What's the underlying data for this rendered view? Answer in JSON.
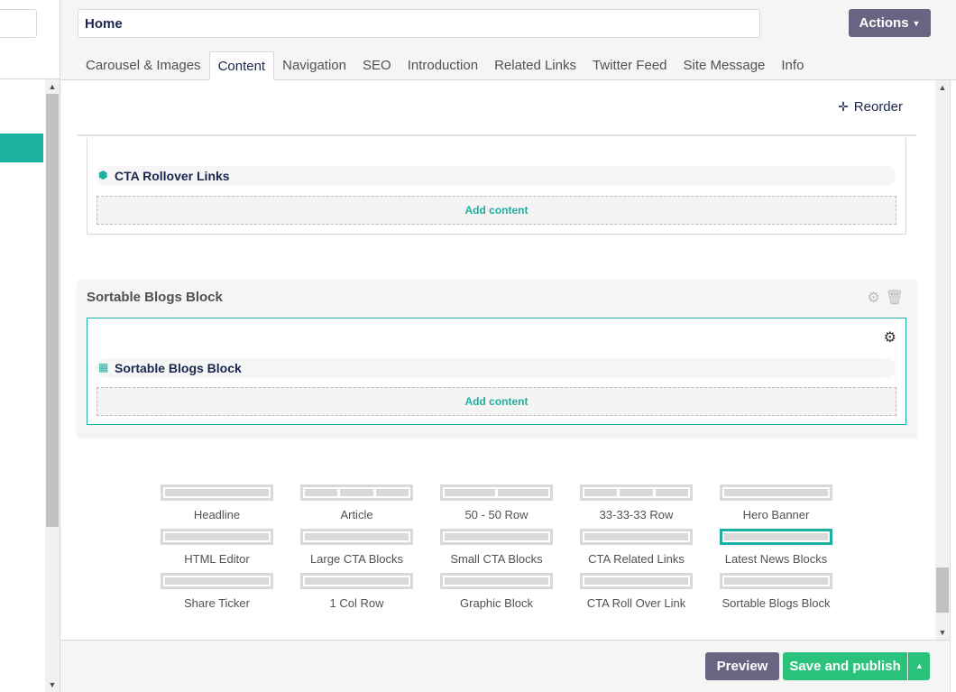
{
  "editor": {
    "name_value": "Home",
    "actions_label": "Actions"
  },
  "tabs": [
    {
      "label": "Carousel & Images"
    },
    {
      "label": "Content"
    },
    {
      "label": "Navigation"
    },
    {
      "label": "SEO"
    },
    {
      "label": "Introduction"
    },
    {
      "label": "Related Links"
    },
    {
      "label": "Twitter Feed"
    },
    {
      "label": "Site Message"
    },
    {
      "label": "Info"
    }
  ],
  "active_tab": "Content",
  "content": {
    "reorder_label": "Reorder",
    "cta_block": {
      "row_label": "CTA Rollover Links",
      "row_icon": "cube-icon",
      "add_content_label": "Add content"
    },
    "sortable_section": {
      "title": "Sortable Blogs Block",
      "row_label": "Sortable Blogs Block",
      "row_icon": "grid-icon",
      "add_content_label": "Add content"
    },
    "layouts": [
      {
        "label": "Headline",
        "cells": 1
      },
      {
        "label": "Article",
        "cells": 3
      },
      {
        "label": "50 - 50 Row",
        "cells": 2
      },
      {
        "label": "33-33-33 Row",
        "cells": 3
      },
      {
        "label": "Hero Banner",
        "cells": 1
      },
      {
        "label": "HTML Editor",
        "cells": 1
      },
      {
        "label": "Large CTA Blocks",
        "cells": 1
      },
      {
        "label": "Small CTA Blocks",
        "cells": 1
      },
      {
        "label": "CTA Related Links",
        "cells": 1
      },
      {
        "label": "Latest News Blocks",
        "cells": 1,
        "selected": true
      },
      {
        "label": "Share Ticker",
        "cells": 1
      },
      {
        "label": "1 Col Row",
        "cells": 1
      },
      {
        "label": "Graphic Block",
        "cells": 1
      },
      {
        "label": "CTA Roll Over Link",
        "cells": 1
      },
      {
        "label": "Sortable Blogs Block",
        "cells": 1
      }
    ]
  },
  "footer": {
    "preview_label": "Preview",
    "publish_label": "Save and publish"
  },
  "colors": {
    "accent": "#1cb0a0",
    "primary_button": "#6a6482",
    "publish_button": "#2bc37c",
    "text_dark": "#1b264f"
  }
}
